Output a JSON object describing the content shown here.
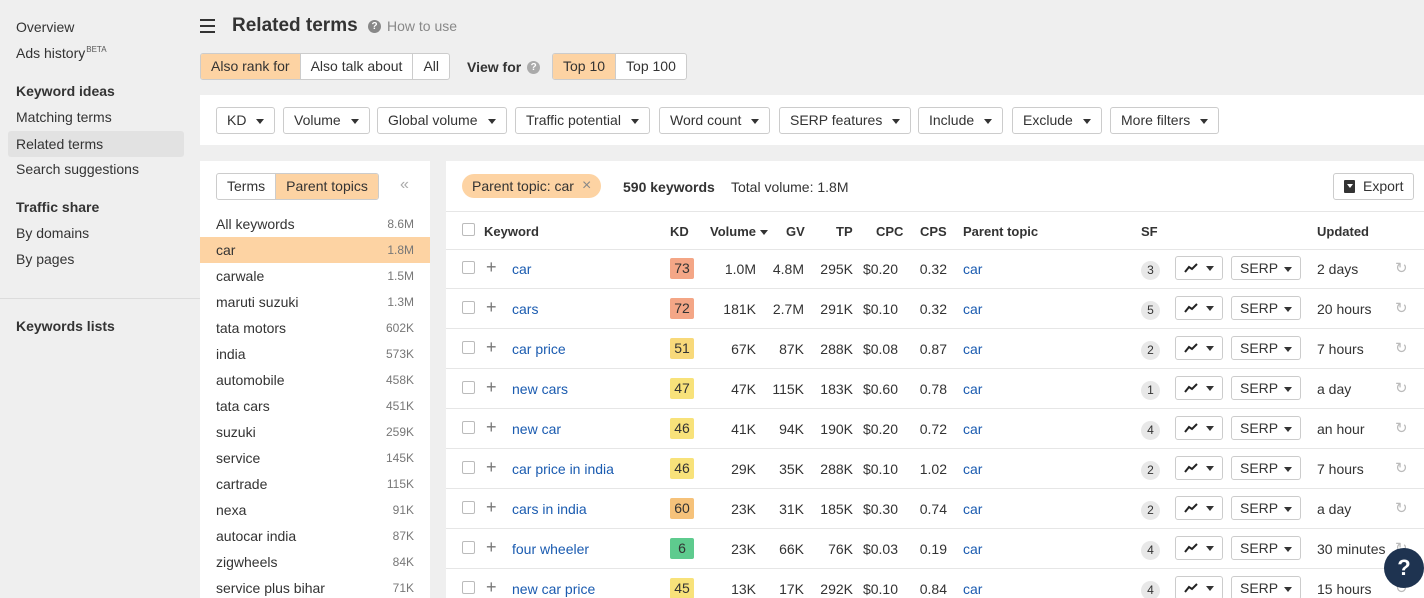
{
  "nav": {
    "overview": "Overview",
    "ads_history": "Ads history",
    "beta": "BETA",
    "keyword_ideas": "Keyword ideas",
    "matching_terms": "Matching terms",
    "related_terms": "Related terms",
    "search_suggestions": "Search suggestions",
    "traffic_share": "Traffic share",
    "by_domains": "By domains",
    "by_pages": "By pages",
    "keywords_lists": "Keywords lists"
  },
  "header": {
    "title": "Related terms",
    "how_to_use": "How to use",
    "mode_tabs": [
      "Also rank for",
      "Also talk about",
      "All"
    ],
    "view_for": "View for",
    "view_tabs": [
      "Top 10",
      "Top 100"
    ]
  },
  "filters": [
    "KD",
    "Volume",
    "Global volume",
    "Traffic potential",
    "Word count",
    "SERP features",
    "Include",
    "Exclude",
    "More filters"
  ],
  "parent_panel": {
    "tabs": [
      "Terms",
      "Parent topics"
    ],
    "collapse": "«",
    "items": [
      {
        "label": "All keywords",
        "count": "8.6M"
      },
      {
        "label": "car",
        "count": "1.8M"
      },
      {
        "label": "carwale",
        "count": "1.5M"
      },
      {
        "label": "maruti suzuki",
        "count": "1.3M"
      },
      {
        "label": "tata motors",
        "count": "602K"
      },
      {
        "label": "india",
        "count": "573K"
      },
      {
        "label": "automobile",
        "count": "458K"
      },
      {
        "label": "tata cars",
        "count": "451K"
      },
      {
        "label": "suzuki",
        "count": "259K"
      },
      {
        "label": "service",
        "count": "145K"
      },
      {
        "label": "cartrade",
        "count": "115K"
      },
      {
        "label": "nexa",
        "count": "91K"
      },
      {
        "label": "autocar india",
        "count": "87K"
      },
      {
        "label": "zigwheels",
        "count": "84K"
      },
      {
        "label": "service plus bihar",
        "count": "71K"
      }
    ]
  },
  "table": {
    "chip": "Parent topic: car",
    "keywords_count": "590 keywords",
    "total_volume": "Total volume: 1.8M",
    "export": "Export",
    "headers": {
      "keyword": "Keyword",
      "kd": "KD",
      "volume": "Volume",
      "gv": "GV",
      "tp": "TP",
      "cpc": "CPC",
      "cps": "CPS",
      "parent": "Parent topic",
      "sf": "SF",
      "updated": "Updated"
    },
    "serp_label": "SERP",
    "rows": [
      {
        "keyword": "car",
        "kd": "73",
        "kd_color": "#f4a686",
        "volume": "1.0M",
        "gv": "4.8M",
        "tp": "295K",
        "cpc": "$0.20",
        "cps": "0.32",
        "parent": "car",
        "sf": "3",
        "updated": "2 days"
      },
      {
        "keyword": "cars",
        "kd": "72",
        "kd_color": "#f4a686",
        "volume": "181K",
        "gv": "2.7M",
        "tp": "291K",
        "cpc": "$0.10",
        "cps": "0.32",
        "parent": "car",
        "sf": "5",
        "updated": "20 hours"
      },
      {
        "keyword": "car price",
        "kd": "51",
        "kd_color": "#f8d97a",
        "volume": "67K",
        "gv": "87K",
        "tp": "288K",
        "cpc": "$0.08",
        "cps": "0.87",
        "parent": "car",
        "sf": "2",
        "updated": "7 hours"
      },
      {
        "keyword": "new cars",
        "kd": "47",
        "kd_color": "#f8e27a",
        "volume": "47K",
        "gv": "115K",
        "tp": "183K",
        "cpc": "$0.60",
        "cps": "0.78",
        "parent": "car",
        "sf": "1",
        "updated": "a day"
      },
      {
        "keyword": "new car",
        "kd": "46",
        "kd_color": "#f8e27a",
        "volume": "41K",
        "gv": "94K",
        "tp": "190K",
        "cpc": "$0.20",
        "cps": "0.72",
        "parent": "car",
        "sf": "4",
        "updated": "an hour"
      },
      {
        "keyword": "car price in india",
        "kd": "46",
        "kd_color": "#f8e27a",
        "volume": "29K",
        "gv": "35K",
        "tp": "288K",
        "cpc": "$0.10",
        "cps": "1.02",
        "parent": "car",
        "sf": "2",
        "updated": "7 hours"
      },
      {
        "keyword": "cars in india",
        "kd": "60",
        "kd_color": "#f6c27a",
        "volume": "23K",
        "gv": "31K",
        "tp": "185K",
        "cpc": "$0.30",
        "cps": "0.74",
        "parent": "car",
        "sf": "2",
        "updated": "a day"
      },
      {
        "keyword": "four wheeler",
        "kd": "6",
        "kd_color": "#5ecb8e",
        "volume": "23K",
        "gv": "66K",
        "tp": "76K",
        "cpc": "$0.03",
        "cps": "0.19",
        "parent": "car",
        "sf": "4",
        "updated": "30 minutes"
      },
      {
        "keyword": "new car price",
        "kd": "45",
        "kd_color": "#f8e27a",
        "volume": "13K",
        "gv": "17K",
        "tp": "292K",
        "cpc": "$0.10",
        "cps": "0.84",
        "parent": "car",
        "sf": "4",
        "updated": "15 hours"
      }
    ]
  },
  "help": "?"
}
